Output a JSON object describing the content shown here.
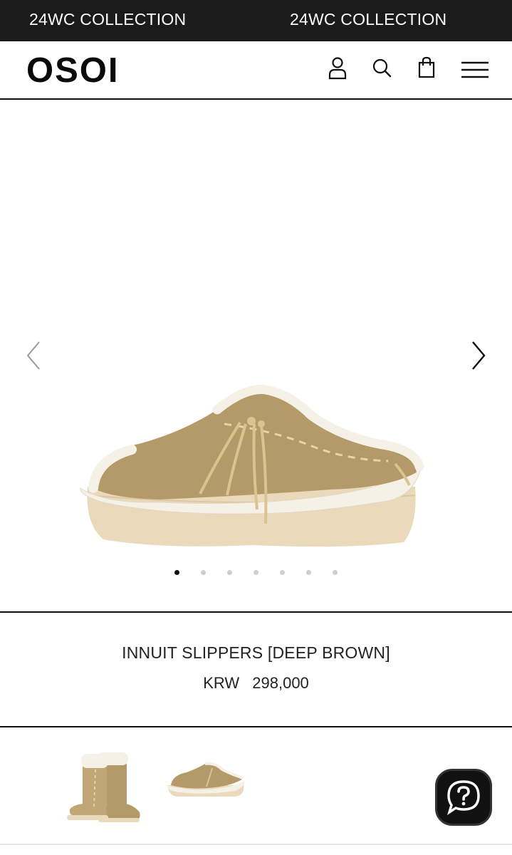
{
  "promo": {
    "left_text": "24WC COLLECTION",
    "right_text": "24WC COLLECTION"
  },
  "header": {
    "logo": "OSOI",
    "icons": [
      "account-icon",
      "search-icon",
      "cart-icon",
      "menu-icon"
    ]
  },
  "gallery": {
    "slide_count": 7,
    "active_slide": 1,
    "image": "slipper-side-view",
    "prev_icon": "chevron-left-icon",
    "next_icon": "chevron-right-icon"
  },
  "product": {
    "name": "INNUIT SLIPPERS [DEEP BROWN]",
    "currency": "KRW",
    "price": "298,000"
  },
  "thumbnails": [
    "boot-thumbnail",
    "slipper-thumbnail"
  ],
  "help": {
    "icon": "help-chat-icon"
  },
  "colors": {
    "promo_bg": "#1b1b1b",
    "suede": "#b49a68",
    "sole": "#ead9bb",
    "fleece": "#f6f1e7"
  }
}
